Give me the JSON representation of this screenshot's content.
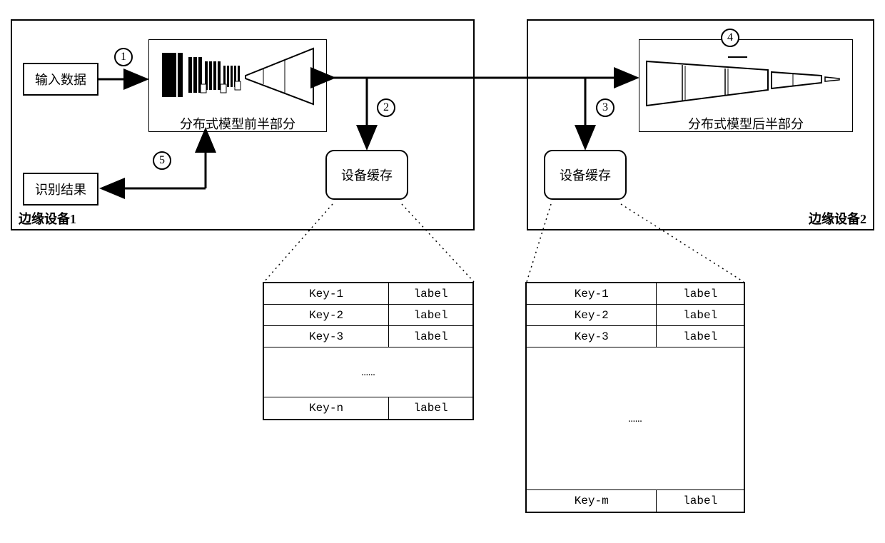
{
  "device1": {
    "label": "边缘设备1",
    "input_data": "输入数据",
    "result": "识别结果",
    "model_caption": "分布式模型前半部分",
    "cache": "设备缓存"
  },
  "device2": {
    "label": "边缘设备2",
    "model_caption": "分布式模型后半部分",
    "cache": "设备缓存"
  },
  "steps": {
    "s1": "1",
    "s2": "2",
    "s3": "3",
    "s4": "4",
    "s5": "5"
  },
  "table1": {
    "rows": [
      {
        "k": "Key-1",
        "v": "label"
      },
      {
        "k": "Key-2",
        "v": "label"
      },
      {
        "k": "Key-3",
        "v": "label"
      }
    ],
    "filler": "……",
    "last": {
      "k": "Key-n",
      "v": "label"
    }
  },
  "table2": {
    "rows": [
      {
        "k": "Key-1",
        "v": "label"
      },
      {
        "k": "Key-2",
        "v": "label"
      },
      {
        "k": "Key-3",
        "v": "label"
      }
    ],
    "filler": "……",
    "last": {
      "k": "Key-m",
      "v": "label"
    }
  }
}
